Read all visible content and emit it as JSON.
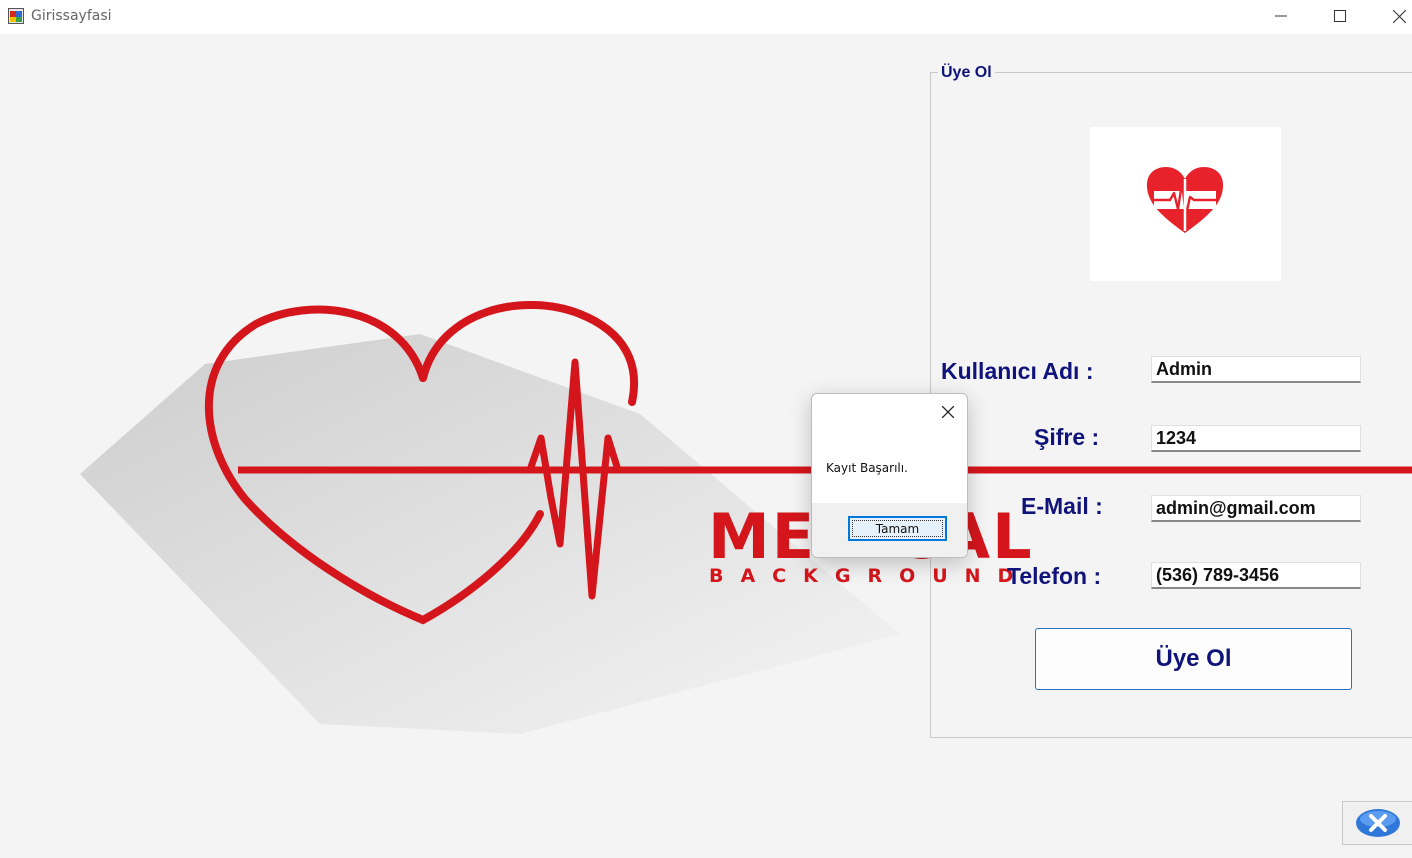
{
  "window": {
    "title": "Girissayfasi",
    "icons": {
      "app": "app-window-icon",
      "minimize": "minimize-icon",
      "maximize": "maximize-icon",
      "close": "close-icon"
    }
  },
  "background": {
    "brand_title": "MEDICAL",
    "brand_subtitle": "BACKGROUND",
    "accent_color": "#d4161c",
    "icons": {
      "heart": "heart-ekg-icon"
    }
  },
  "form": {
    "group_title": "Üye Ol",
    "logo_icon": "heart-pulse-logo-icon",
    "fields": {
      "username": {
        "label": "Kullanıcı Adı :",
        "value": "Admin"
      },
      "password": {
        "label": "Şifre :",
        "value": "1234"
      },
      "email": {
        "label": "E-Mail :",
        "value": "admin@gmail.com"
      },
      "phone": {
        "label": "Telefon :",
        "value": "(536) 789-3456"
      }
    },
    "submit_label": "Üye Ol",
    "label_color": "#10147a"
  },
  "exit_button": {
    "icon": "close-circle-icon"
  },
  "dialog": {
    "message": "Kayıt Başarılı.",
    "ok_label": "Tamam",
    "close_icon": "close-icon"
  }
}
